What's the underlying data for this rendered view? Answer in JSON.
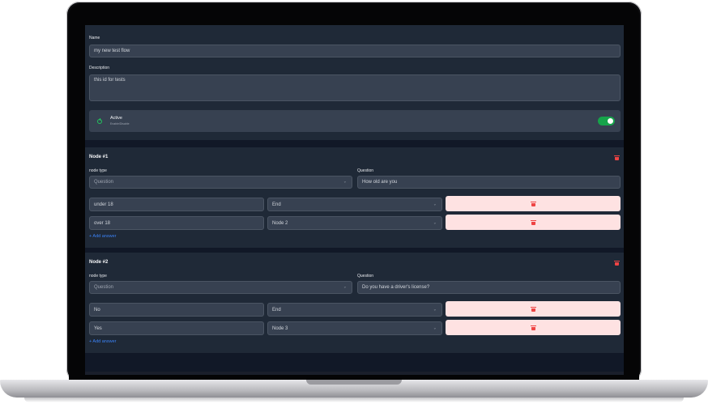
{
  "flow": {
    "name_label": "Name",
    "name_value": "my new test flow",
    "description_label": "Description",
    "description_value": "this id for tests",
    "active_label": "Active",
    "active_sub": "Enable/Disable",
    "active": true
  },
  "nodes": [
    {
      "title": "Node #1",
      "node_type_label": "node type",
      "node_type_value": "Question",
      "question_label": "Question",
      "question_value": "How old are you",
      "answers": [
        {
          "text": "under 18",
          "target": "End"
        },
        {
          "text": "over 18",
          "target": "Node 2"
        }
      ],
      "add_answer": "+ Add answer"
    },
    {
      "title": "Node #2",
      "node_type_label": "node type",
      "node_type_value": "Question",
      "question_label": "Question",
      "question_value": "Do you have a driver's license?",
      "answers": [
        {
          "text": "No",
          "target": "End"
        },
        {
          "text": "Yes",
          "target": "Node 3"
        }
      ],
      "add_answer": "+ Add answer"
    }
  ],
  "icons": {
    "delete": "trash-icon",
    "select": "chevron-down-icon",
    "active": "power-icon"
  },
  "colors": {
    "background": "#111827",
    "card": "#1f2937",
    "field": "#374151",
    "toggle_on": "#16a34a",
    "danger": "#ef4444",
    "danger_bg": "#fee2e2",
    "link": "#3b82f6"
  }
}
